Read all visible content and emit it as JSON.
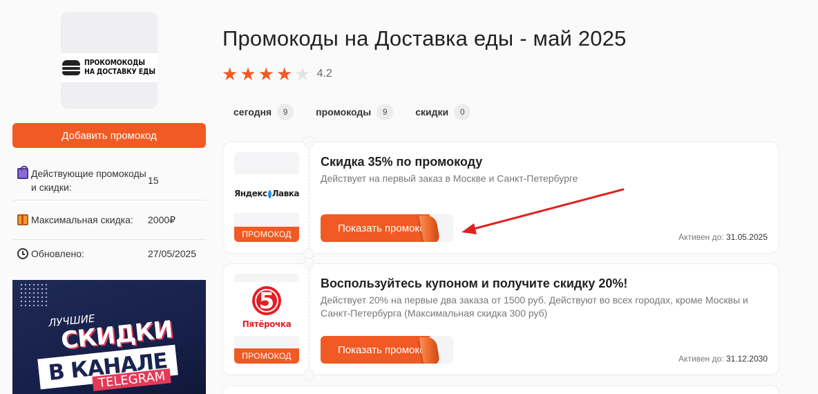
{
  "sidebar": {
    "logo_text_line1": "ПРОКОМОКОДЫ",
    "logo_text_line2": "НА ДОСТАВКУ ЕДЫ",
    "add_button": "Добавить промокод",
    "stats": [
      {
        "icon": "shopping-bags-icon",
        "label": "Действующие промокоды и скидки:",
        "value": "15"
      },
      {
        "icon": "gift-icon",
        "label": "Максимальная скидка:",
        "value": "2000₽"
      },
      {
        "icon": "stopwatch-icon",
        "label": "Обновлено:",
        "value": "27/05/2025"
      }
    ],
    "banner": {
      "line1": "ЛУЧШИЕ",
      "line2": "СКИДКИ",
      "line3": "В КАНАЛЕ",
      "line4": "TELEGRAM"
    }
  },
  "main": {
    "title": "Промокоды на Доставка еды - май 2025",
    "rating": {
      "value": "4.2",
      "stars_full": 4,
      "stars_max": 5
    },
    "filters": [
      {
        "label": "сегодня",
        "count": "9"
      },
      {
        "label": "промокоды",
        "count": "9"
      },
      {
        "label": "скидки",
        "count": "0"
      }
    ],
    "offers": [
      {
        "brand": "Яндекс Лавка",
        "brand_text_left": "Яндекс",
        "brand_text_right": "Лавка",
        "type": "ПРОМОКОД",
        "title": "Скидка 35% по промокоду",
        "desc": "Действует на первый заказ в Москве и Санкт-Петербурге",
        "button": "Показать промокод",
        "active_label": "Активен до:",
        "active_date": "31.05.2025"
      },
      {
        "brand": "Пятёрочка",
        "brand_digit": "5",
        "type": "ПРОМОКОД",
        "title": "Воспользуйтесь купоном и получите скидку 20%!",
        "desc": "Действует 20% на первые два заказа от 1500 руб. Действуют во всех городах, кроме Москвы и Санкт-Петербурга (Максимальная скидка 300 руб)",
        "button": "Показать промокод",
        "active_label": "Активен до:",
        "active_date": "31.12.2030"
      }
    ]
  },
  "colors": {
    "accent": "#f15a24",
    "annotation_arrow": "#e02020"
  }
}
